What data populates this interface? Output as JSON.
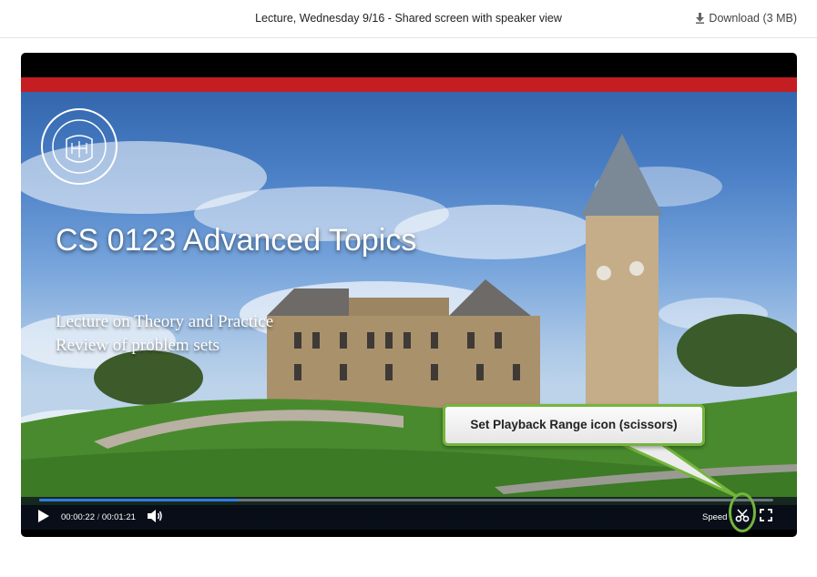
{
  "header": {
    "title": "Lecture, Wednesday 9/16 - Shared screen with speaker view",
    "download_label": "Download (3 MB)",
    "download_icon": "download-arrow-icon"
  },
  "slide": {
    "title": "CS 0123 Advanced Topics",
    "line1": "Lecture on Theory and Practice",
    "line2": "Review of problem sets",
    "seal_text": "CORNELL UNIVERSITY FOUNDED A.D. 1865",
    "accent_color": "#c41e22"
  },
  "player": {
    "current_time": "00:00:22",
    "separator": "/",
    "duration": "00:01:21",
    "progress_fraction": 0.27,
    "speed_label": "Speed",
    "progress_color": "#2f7ae5"
  },
  "callout": {
    "text": "Set Playback Range icon (scissors)",
    "border_color": "#74b53c"
  }
}
